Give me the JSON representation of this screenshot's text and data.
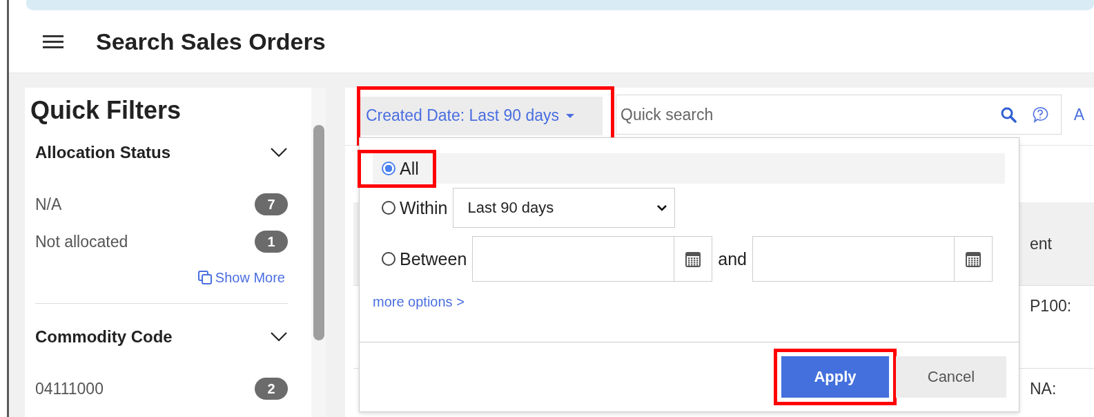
{
  "header": {
    "title": "Search Sales Orders"
  },
  "quick_filters": {
    "title": "Quick Filters",
    "groups": [
      {
        "title": "Allocation Status",
        "expanded": true,
        "items": [
          {
            "label": "N/A",
            "count": "7"
          },
          {
            "label": "Not allocated",
            "count": "1"
          }
        ],
        "show_more": "Show More"
      },
      {
        "title": "Commodity Code",
        "expanded": true,
        "items": [
          {
            "label": "04111000",
            "count": "2"
          }
        ]
      }
    ]
  },
  "filter_bar": {
    "date_filter": {
      "label": "Created Date: Last 90 days",
      "highlighted": true
    },
    "search": {
      "placeholder": "Quick search"
    },
    "cut_link": "A"
  },
  "date_popover": {
    "options": [
      {
        "kind": "all",
        "label": "All",
        "selected": true,
        "highlighted": true
      },
      {
        "kind": "within",
        "label": "Within",
        "selected": false,
        "value": "Last 90 days"
      },
      {
        "kind": "between",
        "label": "Between",
        "selected": false,
        "joiner": "and"
      }
    ],
    "more_options": "more options >",
    "buttons": [
      {
        "kind": "primary",
        "label": "Apply",
        "highlighted": true
      },
      {
        "kind": "secondary",
        "label": "Cancel"
      }
    ]
  },
  "results_table": {
    "partial_texts": [
      "ent",
      "P100:",
      "NA:"
    ]
  }
}
